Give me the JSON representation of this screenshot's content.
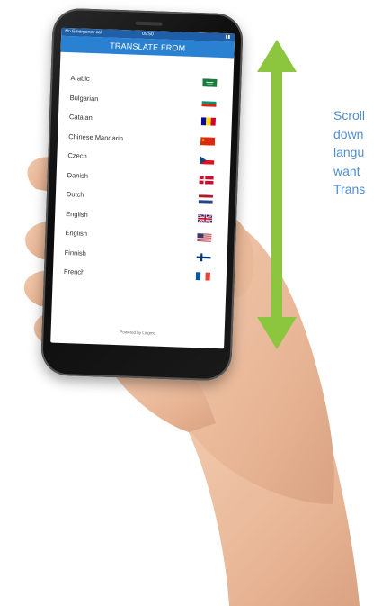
{
  "status_bar": {
    "left": "No Emergency call",
    "time": "09:50",
    "right": "▮▮"
  },
  "header": {
    "title": "TRANSLATE FROM"
  },
  "languages": [
    {
      "name": "Arabic",
      "flag": "saudi-arabia"
    },
    {
      "name": "Bulgarian",
      "flag": "bulgaria"
    },
    {
      "name": "Catalan",
      "flag": "andorra"
    },
    {
      "name": "Chinese Mandarin",
      "flag": "china"
    },
    {
      "name": "Czech",
      "flag": "czech-republic"
    },
    {
      "name": "Danish",
      "flag": "denmark"
    },
    {
      "name": "Dutch",
      "flag": "netherlands"
    },
    {
      "name": "English",
      "flag": "united-kingdom"
    },
    {
      "name": "English",
      "flag": "united-states"
    },
    {
      "name": "Finnish",
      "flag": "finland"
    },
    {
      "name": "French",
      "flag": "france"
    }
  ],
  "footer": {
    "powered_by": "Powered by Lingmo"
  },
  "instruction": {
    "lines": [
      "Scroll",
      "down",
      "langu",
      "want",
      "Trans"
    ]
  },
  "colors": {
    "title_bar": "#2a80d1",
    "status_bar": "#1e5fa8",
    "arrow": "#8cc63f",
    "instruction_text": "#4f8fd1"
  }
}
